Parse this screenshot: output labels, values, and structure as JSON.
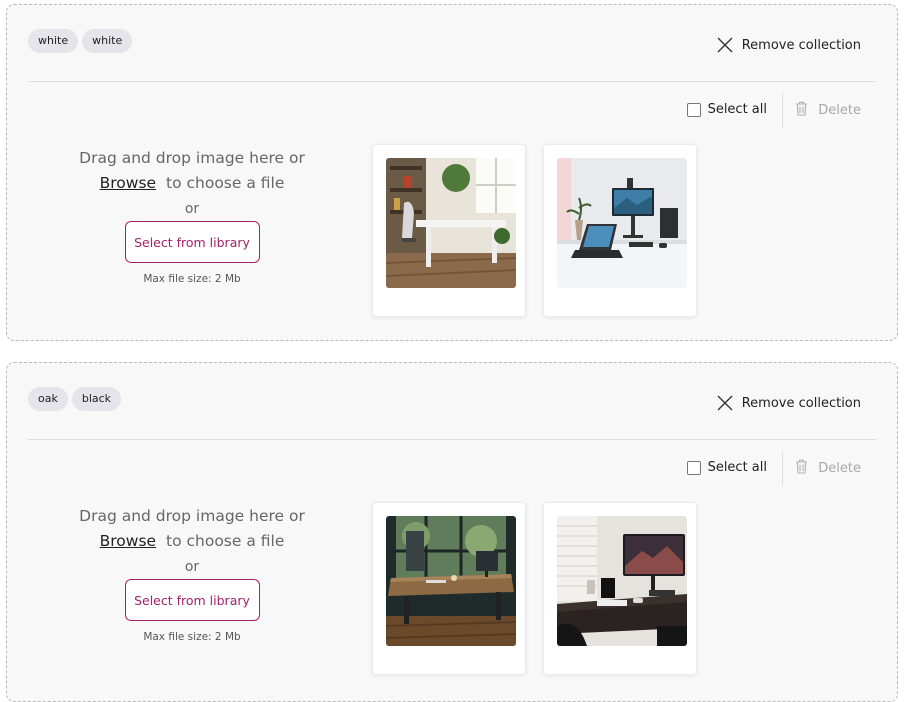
{
  "collections": [
    {
      "tags": [
        "white",
        "white"
      ],
      "remove_label": "Remove collection",
      "select_all_label": "Select all",
      "delete_label": "Delete",
      "dropzone": {
        "drag_text": "Drag and drop image here or",
        "browse_label": "Browse",
        "choose_text": "to choose a file",
        "or_text": "or",
        "library_button": "Select from library",
        "max_size": "Max file size: 2 Mb"
      },
      "images": [
        {
          "icon": "white-desk-room-photo"
        },
        {
          "icon": "white-desk-monitor-photo"
        }
      ]
    },
    {
      "tags": [
        "oak",
        "black"
      ],
      "remove_label": "Remove collection",
      "select_all_label": "Select all",
      "delete_label": "Delete",
      "dropzone": {
        "drag_text": "Drag and drop image here or",
        "browse_label": "Browse",
        "choose_text": "to choose a file",
        "or_text": "or",
        "library_button": "Select from library",
        "max_size": "Max file size: 2 Mb"
      },
      "images": [
        {
          "icon": "oak-desk-window-photo"
        },
        {
          "icon": "dark-desk-monitor-photo"
        }
      ]
    }
  ],
  "colors": {
    "accent": "#a0226a",
    "panel_bg": "#f8f8f8",
    "tag_bg": "#e4e4ea",
    "disabled_text": "#a8a8a8"
  }
}
